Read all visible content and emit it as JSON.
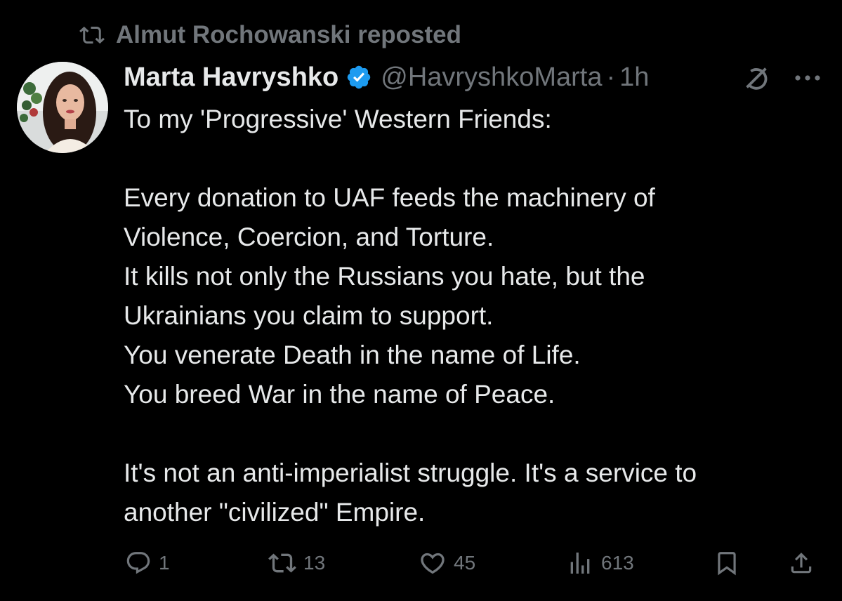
{
  "repost_banner": {
    "icon": "repost-icon",
    "text": "Almut Rochowanski reposted"
  },
  "tweet": {
    "author": {
      "display_name": "Marta Havryshko",
      "handle": "@HavryshkoMarta",
      "verified": true,
      "verified_color": "#1d9bf0"
    },
    "separator": "·",
    "time": "1h",
    "header_icons": [
      "grok-icon",
      "more-icon"
    ],
    "body_lines": [
      "To my 'Progressive' Western Friends:",
      "",
      "Every donation to UAF feeds the machinery of",
      "Violence, Coercion, and Torture.",
      "It kills not only the Russians you hate, but the",
      "Ukrainians you claim to support.",
      "You venerate Death in the name of Life.",
      "You breed War in the name of Peace.",
      "",
      "It's not an anti-imperialist struggle. It's a service to",
      "another \"civilized\" Empire."
    ],
    "actions": {
      "reply": {
        "icon": "reply-icon",
        "count": "1"
      },
      "repost": {
        "icon": "repost-icon",
        "count": "13"
      },
      "like": {
        "icon": "heart-icon",
        "count": "45"
      },
      "views": {
        "icon": "views-icon",
        "count": "613"
      },
      "bookmark": {
        "icon": "bookmark-icon"
      },
      "share": {
        "icon": "share-icon"
      }
    }
  },
  "colors": {
    "background": "#000000",
    "text_primary": "#e7e9ea",
    "text_secondary": "#71767b",
    "accent": "#1d9bf0"
  }
}
